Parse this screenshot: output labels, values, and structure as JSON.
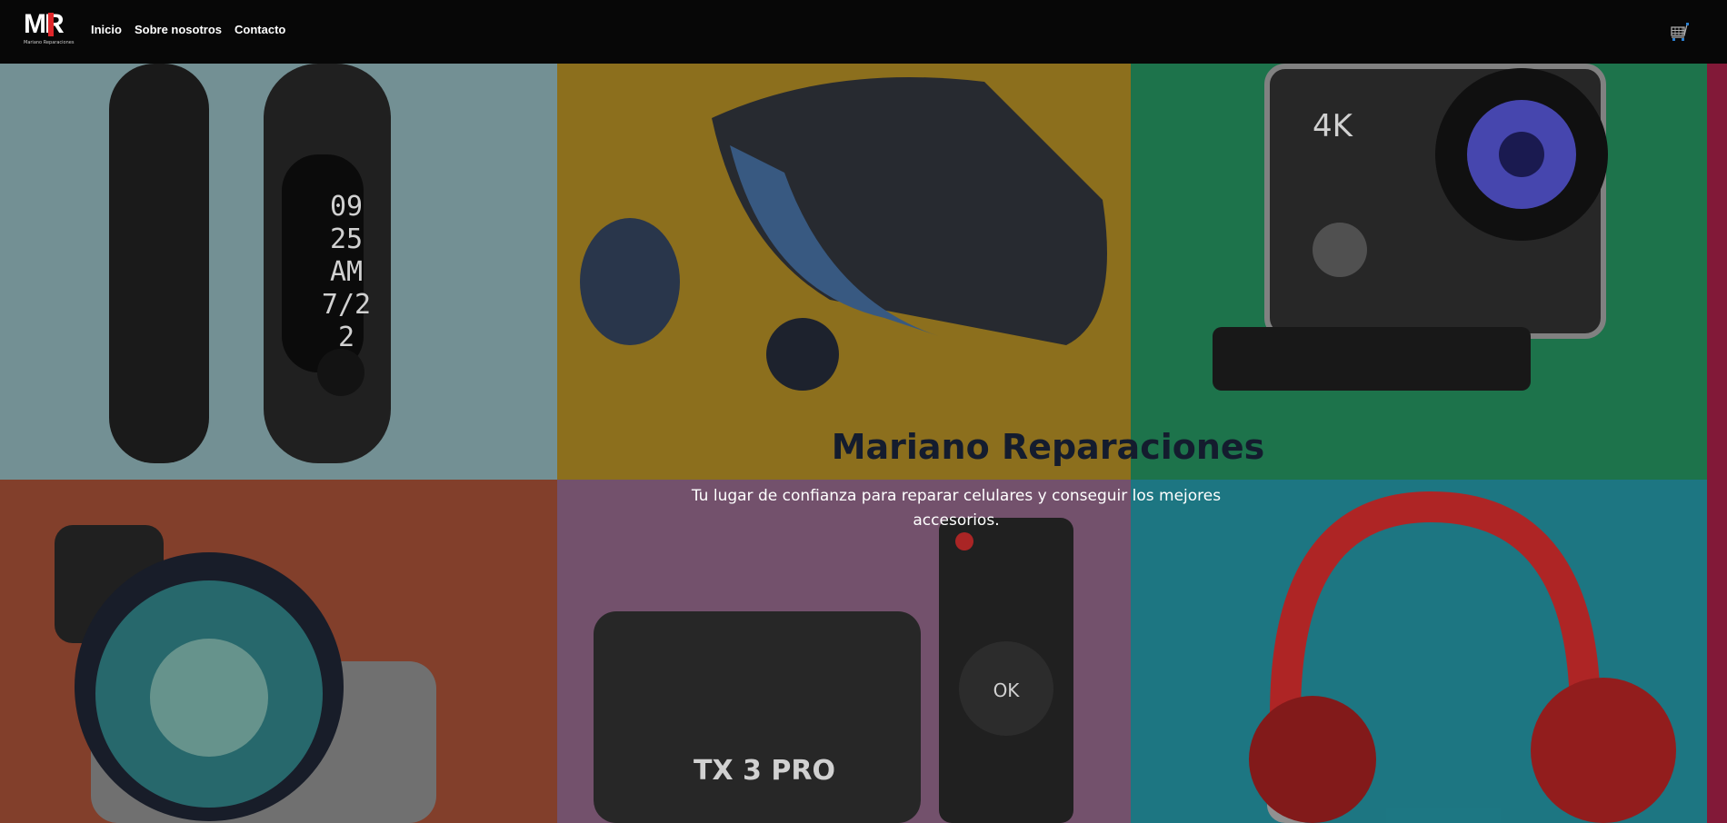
{
  "nav": {
    "logo_text": "MR",
    "logo_subtitle": "Mariano Reparaciones",
    "links": [
      "Inicio",
      "Sobre nosotros",
      "Contacto"
    ],
    "cart_icon": "shopping-cart-icon"
  },
  "hero": {
    "title": "Mariano Reparaciones",
    "subtitle": "Tu lugar de confianza para reparar celulares y conseguir los mejores accesorios."
  },
  "gallery": {
    "panels": [
      {
        "product": "smart-band",
        "color": "#7a989c",
        "screen_text": "09 25 AM 7/22"
      },
      {
        "product": "vr-headset",
        "color": "#94751f"
      },
      {
        "product": "action-camera",
        "color": "#1f7a50",
        "label": "4K"
      },
      {
        "product": "phone-lens",
        "color": "#8a432e"
      },
      {
        "product": "tv-box-remote",
        "color": "#7a5672",
        "label": "TX 3 PRO",
        "remote_key": "OK"
      },
      {
        "product": "headphones",
        "color": "#1f7d8a"
      }
    ]
  }
}
